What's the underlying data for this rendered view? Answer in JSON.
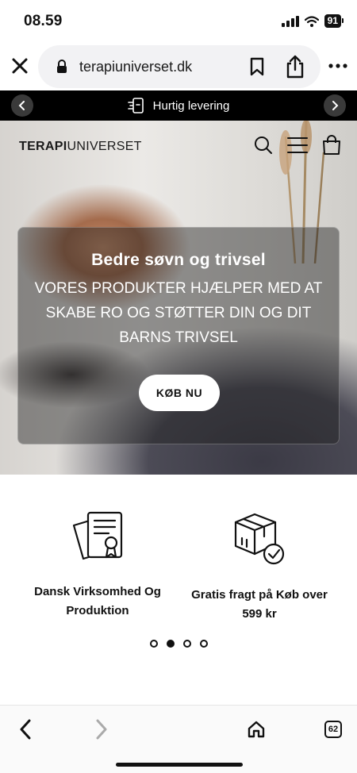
{
  "status_bar": {
    "time": "08.59",
    "battery": "91"
  },
  "browser": {
    "url": "terapiuniverset.dk",
    "tab_count": "62"
  },
  "announcement": {
    "text": "Hurtig levering"
  },
  "header": {
    "logo_bold": "TERAPI",
    "logo_regular": "UNIVERSET"
  },
  "hero": {
    "title": "Bedre søvn og trivsel",
    "subtitle": "VORES PRODUKTER HJÆLPER MED AT SKABE RO OG STØTTER DIN OG DIT BARNS TRIVSEL",
    "cta_label": "KØB NU"
  },
  "features": [
    {
      "icon": "certificate-icon",
      "label": "Dansk Virksomhed Og Produktion"
    },
    {
      "icon": "package-check-icon",
      "label": "Gratis fragt på Køb over 599 kr"
    }
  ],
  "carousel": {
    "active_index": 1,
    "dot_count": 4
  },
  "colors": {
    "announcement_bg": "#000000",
    "button_bg": "#ffffff",
    "text": "#111111"
  }
}
